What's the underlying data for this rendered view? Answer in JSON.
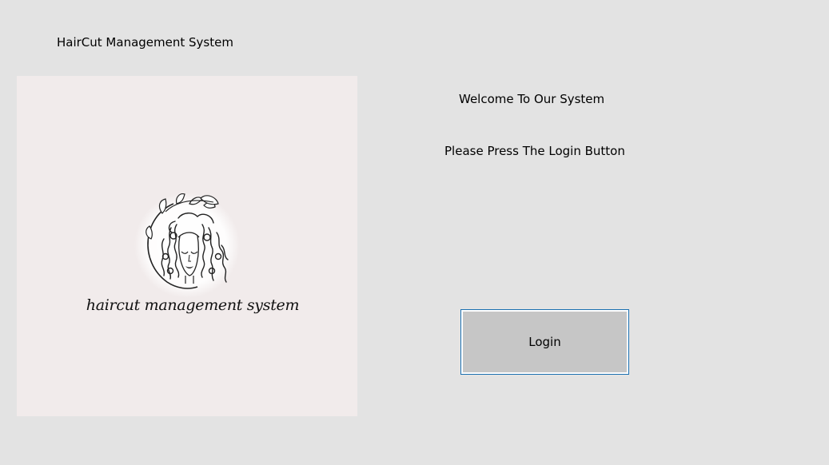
{
  "app": {
    "title": "HairCut Management System"
  },
  "logo": {
    "caption": "haircut management system",
    "icon": "woman-curly-hair-logo"
  },
  "main": {
    "welcome_text": "Welcome To Our System",
    "instruction_text": "Please Press The Login Button",
    "login_label": "Login"
  },
  "colors": {
    "window_background": "#e3e3e3",
    "logo_background": "#f1ebeb",
    "button_background": "#c6c6c6",
    "button_border": "#1a6fb0"
  }
}
